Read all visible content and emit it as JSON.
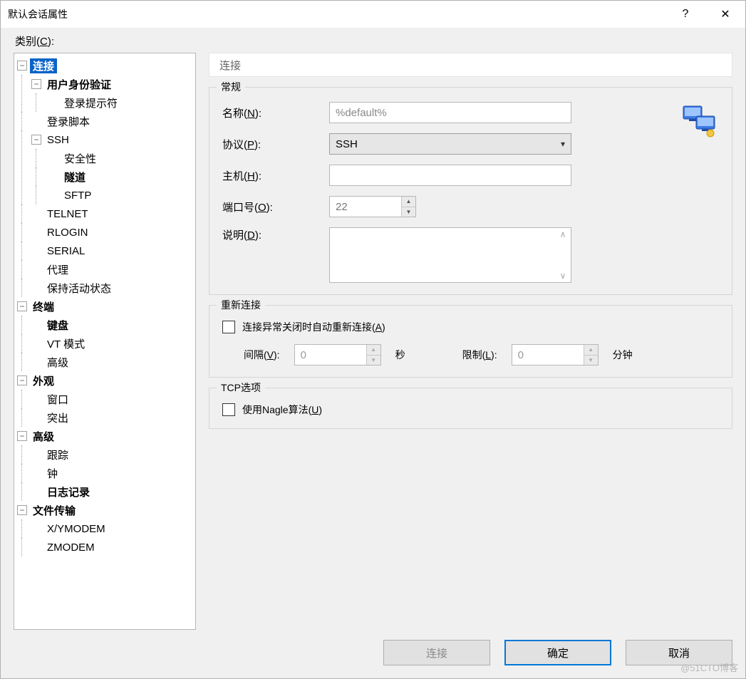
{
  "window": {
    "title": "默认会话属性",
    "help_symbol": "?",
    "close_symbol": "✕"
  },
  "category_label": "类别(C):",
  "tree": {
    "connection": "连接",
    "user_auth": "用户身份验证",
    "login_prompt": "登录提示符",
    "login_script": "登录脚本",
    "ssh": "SSH",
    "security": "安全性",
    "tunnel": "隧道",
    "sftp": "SFTP",
    "telnet": "TELNET",
    "rlogin": "RLOGIN",
    "serial": "SERIAL",
    "proxy": "代理",
    "keepalive": "保持活动状态",
    "terminal": "终端",
    "keyboard": "键盘",
    "vt_mode": "VT 模式",
    "advanced_term": "高级",
    "appearance": "外观",
    "window": "窗口",
    "highlight": "突出",
    "advanced": "高级",
    "trace": "跟踪",
    "bell": "钟",
    "logging": "日志记录",
    "file_transfer": "文件传输",
    "xymodem": "X/YMODEM",
    "zmodem": "ZMODEM"
  },
  "page": {
    "header": "连接",
    "general": {
      "legend": "常规",
      "name_label": "名称(N):",
      "name_value": "%default%",
      "protocol_label": "协议(P):",
      "protocol_value": "SSH",
      "host_label": "主机(H):",
      "host_value": "",
      "port_label": "端口号(O):",
      "port_value": "22",
      "desc_label": "说明(D):",
      "desc_value": ""
    },
    "reconnect": {
      "legend": "重新连接",
      "auto_label": "连接异常关闭时自动重新连接(A)",
      "interval_label": "间隔(V):",
      "interval_value": "0",
      "interval_unit": "秒",
      "limit_label": "限制(L):",
      "limit_value": "0",
      "limit_unit": "分钟"
    },
    "tcp": {
      "legend": "TCP选项",
      "nagle_label": "使用Nagle算法(U)"
    }
  },
  "buttons": {
    "connect": "连接",
    "ok": "确定",
    "cancel": "取消"
  },
  "watermark": "@51CTO博客"
}
